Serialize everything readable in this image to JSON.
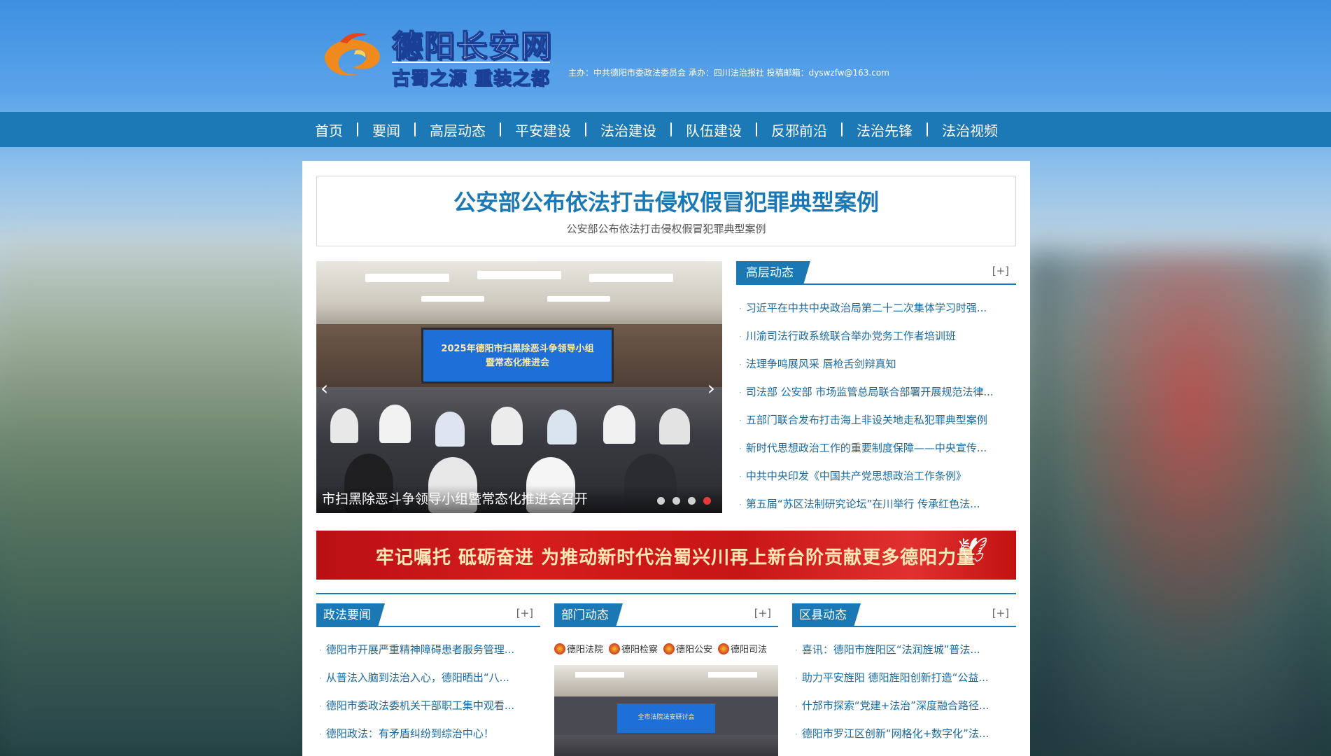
{
  "site": {
    "logo_title": "德阳长安网",
    "logo_slogan": "古蜀之源 重装之都",
    "sponsor": "主办：中共德阳市委政法委员会 承办：四川法治报社 投稿邮箱：dyswzfw@163.com"
  },
  "nav": {
    "items": [
      "首页",
      "要闻",
      "高层动态",
      "平安建设",
      "法治建设",
      "队伍建设",
      "反邪前沿",
      "法治先锋",
      "法治视频"
    ]
  },
  "headline": {
    "title": "公安部公布依法打击侵权假冒犯罪典型案例",
    "subtitle": "公安部公布依法打击侵权假冒犯罪典型案例"
  },
  "slider": {
    "screen_text_line1": "2025年德阳市扫黑除恶斗争领导小组",
    "screen_text_line2": "暨常态化推进会",
    "caption": "市扫黑除恶斗争领导小组暨常态化推进会召开",
    "dot_count": 4,
    "active_dot": 4,
    "prev_arrow": "‹",
    "next_arrow": "›"
  },
  "high_level": {
    "title": "高层动态",
    "more": "[+]",
    "items": [
      "习近平在中共中央政治局第二十二次集体学习时强...",
      "川渝司法行政系统联合举办党务工作者培训班",
      "法理争鸣展风采 唇枪舌剑辩真知",
      "司法部 公安部 市场监管总局联合部署开展规范法律...",
      "五部门联合发布打击海上非设关地走私犯罪典型案例",
      "新时代思想政治工作的重要制度保障——中央宣传...",
      "中共中央印发《中国共产党思想政治工作条例》",
      "第五届“苏区法制研究论坛”在川举行 传承红色法..."
    ]
  },
  "banner": {
    "text": "牢记嘱托 砥砺奋进 为推动新时代治蜀兴川再上新台阶贡献更多德阳力量"
  },
  "politics_news": {
    "title": "政法要闻",
    "more": "[+]",
    "items": [
      "德阳市开展严重精神障碍患者服务管理...",
      "从普法入脑到法治入心，德阳晒出“八...",
      "德阳市委政法委机关干部职工集中观看...",
      "德阳政法：有矛盾纠纷到综治中心！"
    ]
  },
  "dept_news": {
    "title": "部门动态",
    "more": "[+]",
    "links": [
      "德阳法院",
      "德阳检察",
      "德阳公安",
      "德阳司法"
    ],
    "photo_screen_text": "全市法院法安研讨会"
  },
  "county_news": {
    "title": "区县动态",
    "more": "[+]",
    "items": [
      "喜讯：德阳市旌阳区“法润旌城”普法...",
      "助力平安旌阳 德阳旌阳创新打造“公益...",
      "什邡市探索“党建+法治”深度融合路径...",
      "德阳市罗江区创新“网格化+数字化”法..."
    ]
  },
  "colors": {
    "nav_bg": "#1d78b6",
    "accent": "#1a78b4",
    "banner_red": "#c81515"
  },
  "icons": {
    "bullet": "·",
    "banner_bird": "🕊"
  }
}
